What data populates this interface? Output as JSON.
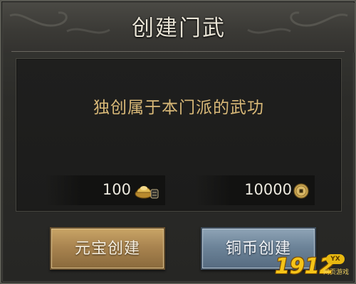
{
  "dialog": {
    "title": "创建门武",
    "description": "独创属于本门派的武功"
  },
  "costs": {
    "ingot": {
      "value": "100",
      "icon": "gold-ingot-icon"
    },
    "coin": {
      "value": "10000",
      "icon": "copper-coin-icon"
    }
  },
  "buttons": {
    "ingot_create": "元宝创建",
    "coin_create": "铜币创建"
  },
  "watermark": {
    "brand": "1912",
    "badge": "YX",
    "sub": "网页游戏"
  },
  "colors": {
    "title_text": "#e9e4d6",
    "description_text": "#d9b978",
    "gold_button": "#a98450",
    "blue_button": "#6d8499"
  }
}
